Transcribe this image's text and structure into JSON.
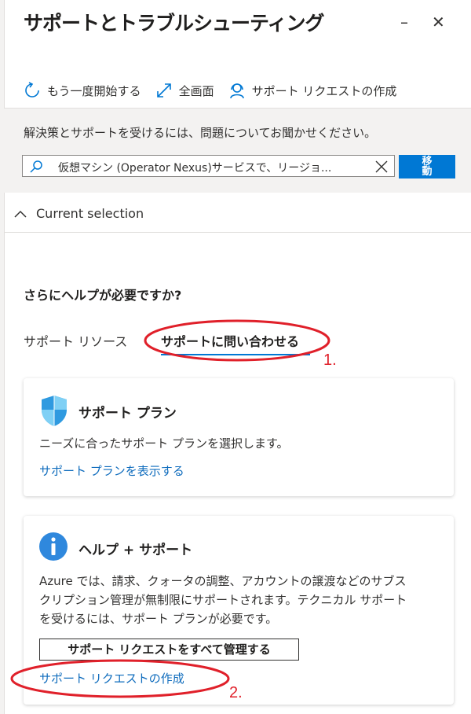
{
  "window": {
    "title": "サポートとトラブルシューティング",
    "minimize_glyph": "–",
    "close_glyph": "✕"
  },
  "toolbar": {
    "restart": {
      "label": "もう一度開始する",
      "icon": "refresh-icon"
    },
    "fullscreen": {
      "label": "全画面",
      "icon": "expand-icon"
    },
    "create_request": {
      "label": "サポート リクエストの作成",
      "icon": "support-agent-icon"
    }
  },
  "banner": {
    "prompt": "解決策とサポートを受けるには、問題についてお聞かせください。",
    "search_value": "仮想マシン (Operator Nexus)サービスで、リージョ...",
    "go_label": "移動"
  },
  "current_selection": {
    "label": "Current selection",
    "expanded": false
  },
  "help": {
    "heading": "さらにヘルプが必要ですか?",
    "tabs": [
      {
        "label": "サポート リソース",
        "selected": false
      },
      {
        "label": "サポートに問い合わせる",
        "selected": true
      }
    ]
  },
  "support_plan_card": {
    "title": "サポート プラン",
    "description": "ニーズに合ったサポート プランを選択します。",
    "link": "サポート プランを表示する",
    "icon": "shield-icon"
  },
  "help_support_card": {
    "title": "ヘルプ + サポート",
    "description_lines": [
      "Azure では、請求、クォータの調整、アカウントの譲渡などのサブス",
      "クリプション管理が無制限にサポートされます。テクニカル サポート",
      "を受けるには、サポート プランが必要です。"
    ],
    "manage_button": "サポート リクエストをすべて管理する",
    "create_link": "サポート リクエストの作成",
    "icon": "info-icon"
  },
  "annotations": [
    {
      "number": "1."
    },
    {
      "number": "2."
    }
  ],
  "colors": {
    "accent": "#0078d4",
    "link": "#0f6cbd",
    "annotation": "#e0202a"
  }
}
